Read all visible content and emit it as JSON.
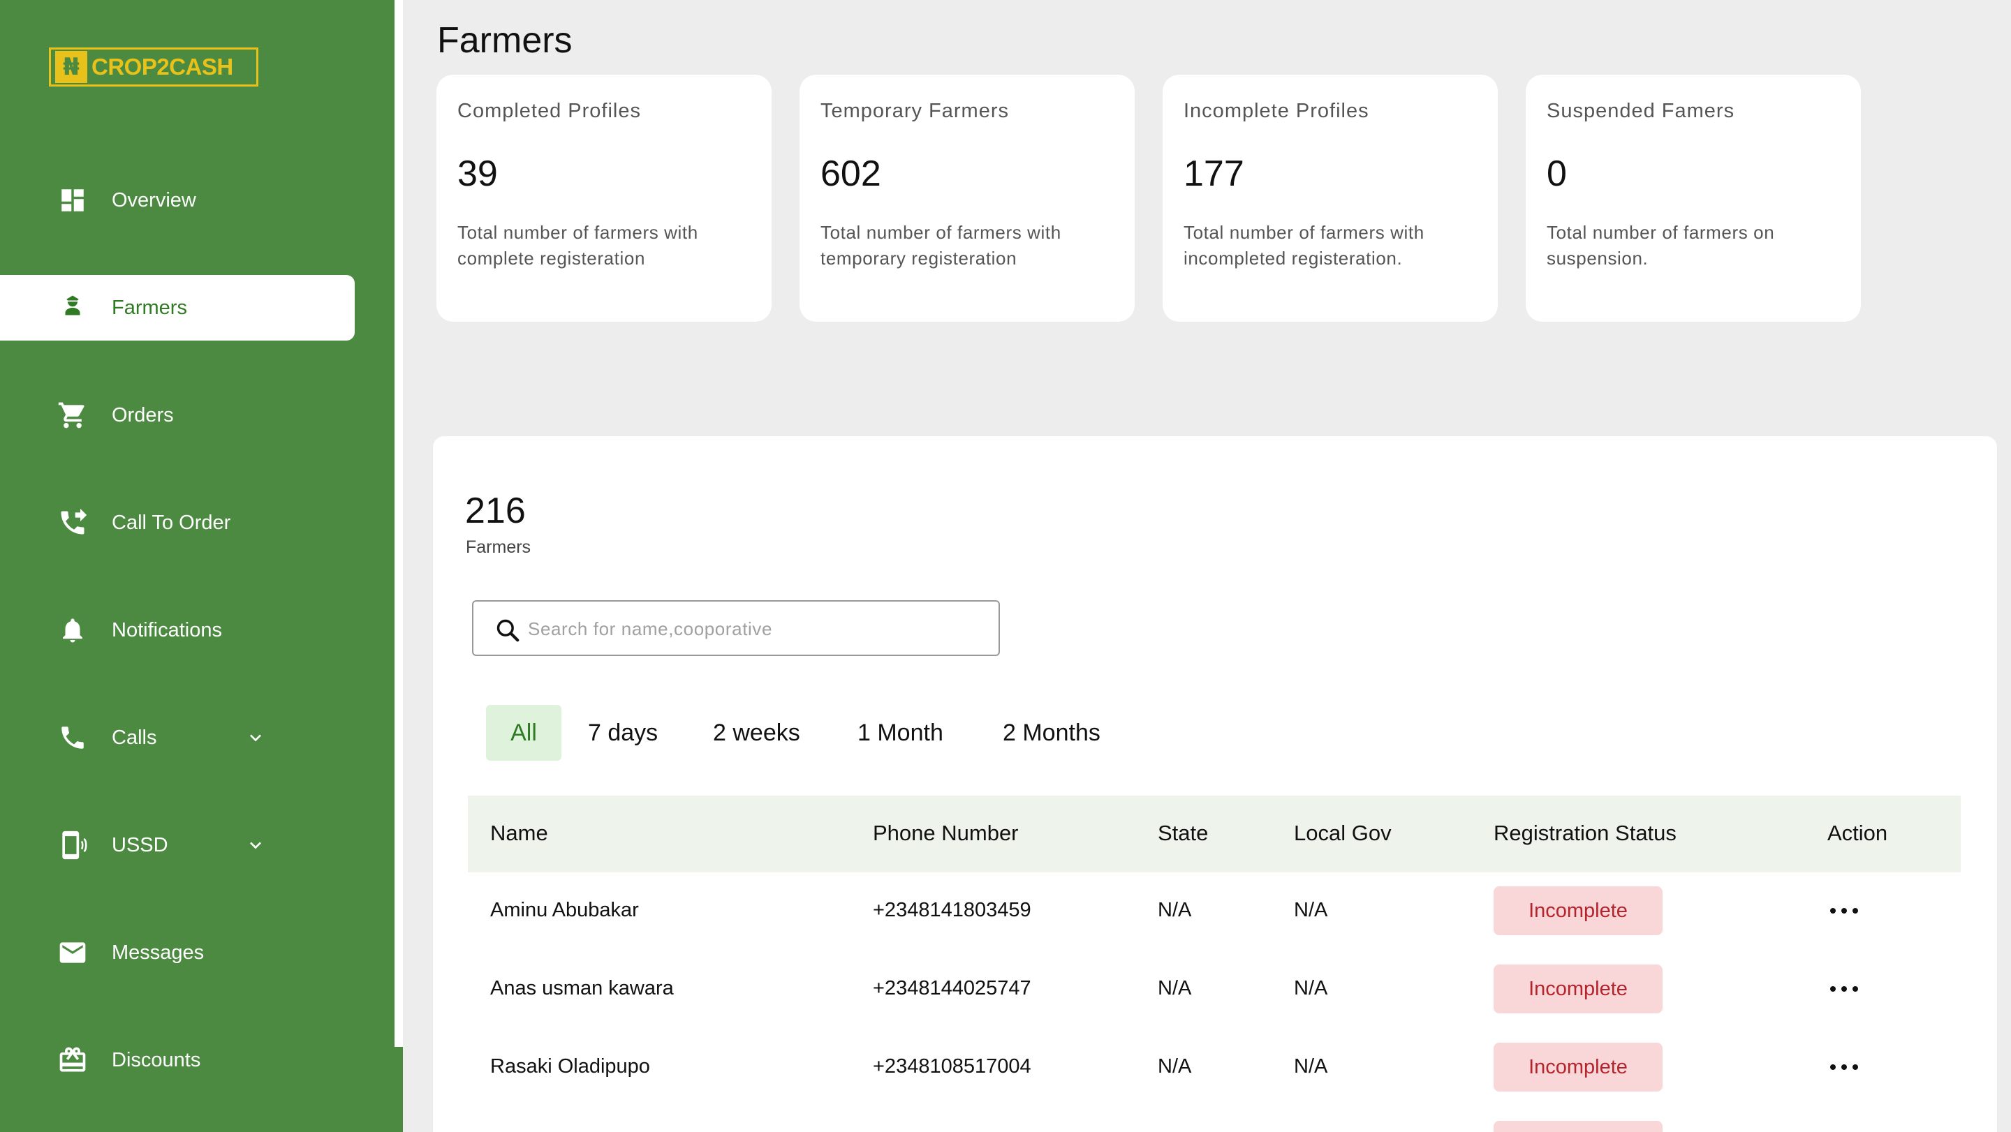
{
  "brand": {
    "logo_text": "CROP2CASH",
    "logo_mark": "₦"
  },
  "sidebar": {
    "items": [
      {
        "label": "Overview",
        "icon": "dashboard-icon"
      },
      {
        "label": "Farmers",
        "icon": "farmer-icon",
        "active": true
      },
      {
        "label": "Orders",
        "icon": "cart-icon"
      },
      {
        "label": "Call To Order",
        "icon": "phone-forward-icon"
      },
      {
        "label": "Notifications",
        "icon": "bell-icon"
      },
      {
        "label": "Calls",
        "icon": "phone-icon",
        "expandable": true
      },
      {
        "label": "USSD",
        "icon": "mobile-signal-icon",
        "expandable": true
      },
      {
        "label": "Messages",
        "icon": "mail-icon"
      },
      {
        "label": "Discounts",
        "icon": "gift-card-icon"
      }
    ]
  },
  "page": {
    "title": "Farmers"
  },
  "stats": [
    {
      "title": "Completed Profiles",
      "value": "39",
      "description": "Total number of farmers with complete registeration"
    },
    {
      "title": "Temporary Farmers",
      "value": "602",
      "description": "Total number of farmers with temporary registeration"
    },
    {
      "title": "Incomplete Profiles",
      "value": "177",
      "description": "Total number of farmers with incompleted registeration."
    },
    {
      "title": "Suspended Famers",
      "value": "0",
      "description": "Total number of farmers on suspension."
    }
  ],
  "summary": {
    "count": "216",
    "label": "Farmers"
  },
  "search": {
    "placeholder": "Search for name,cooporative",
    "value": ""
  },
  "filters": [
    "All",
    "7 days",
    "2 weeks",
    "1 Month",
    "2 Months"
  ],
  "table": {
    "columns": [
      "Name",
      "Phone Number",
      "State",
      "Local Gov",
      "Registration Status",
      "Action"
    ],
    "rows": [
      {
        "name": "Aminu Abubakar",
        "phone": "+2348141803459",
        "state": "N/A",
        "lga": "N/A",
        "status": "Incomplete"
      },
      {
        "name": "Anas usman kawara",
        "phone": "+2348144025747",
        "state": "N/A",
        "lga": "N/A",
        "status": "Incomplete"
      },
      {
        "name": "Rasaki Oladipupo",
        "phone": "+2348108517004",
        "state": "N/A",
        "lga": "N/A",
        "status": "Incomplete"
      }
    ]
  },
  "colors": {
    "sidebar": "#4b8a40",
    "accent": "#2f7a23",
    "badge_bg": "#f9d6d8",
    "badge_text": "#b3242c",
    "logo": "#e8c21a"
  }
}
